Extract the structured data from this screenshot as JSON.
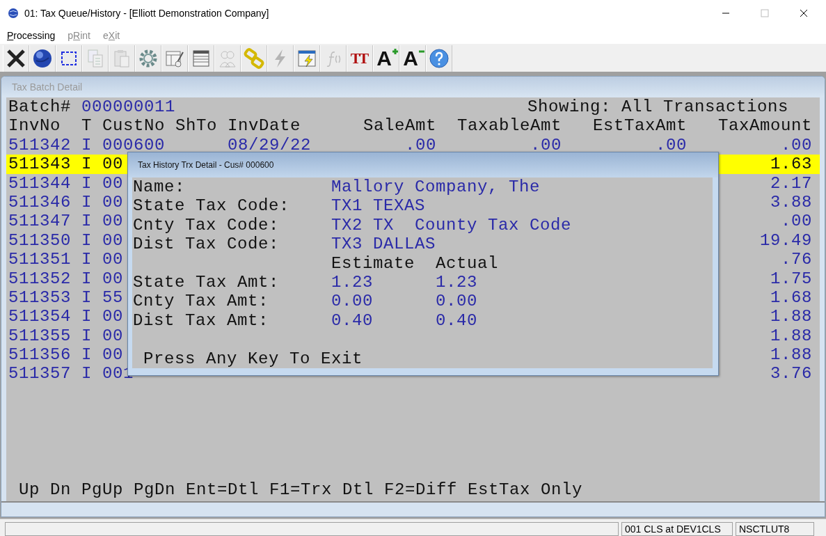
{
  "window": {
    "title": "01: Tax Queue/History - [Elliott Demonstration Company]"
  },
  "menu": [
    {
      "key": "P",
      "after": "rocessing",
      "disabled": false
    },
    {
      "before": "p",
      "key": "R",
      "after": "int",
      "disabled": true
    },
    {
      "before": "e",
      "key": "X",
      "after": "it",
      "disabled": true
    }
  ],
  "toolbar": [
    {
      "kind": "close",
      "disabled": false
    },
    {
      "kind": "globe",
      "disabled": false
    },
    {
      "kind": "select",
      "disabled": false
    },
    {
      "kind": "copy",
      "disabled": true
    },
    {
      "kind": "paste",
      "disabled": true
    },
    {
      "kind": "gear",
      "disabled": false
    },
    {
      "kind": "form",
      "disabled": false
    },
    {
      "kind": "table",
      "disabled": false
    },
    {
      "kind": "people",
      "disabled": true
    },
    {
      "kind": "link",
      "disabled": false
    },
    {
      "kind": "bolt",
      "disabled": true
    },
    {
      "kind": "run",
      "disabled": false
    },
    {
      "kind": "function",
      "disabled": true
    },
    {
      "kind": "text",
      "glyph": "TT",
      "disabled": false
    },
    {
      "kind": "grow",
      "glyph": "A",
      "disabled": false
    },
    {
      "kind": "shrink",
      "glyph": "A",
      "disabled": false
    },
    {
      "kind": "help",
      "disabled": false
    }
  ],
  "child_window": {
    "title": "Tax Batch Detail"
  },
  "batch": {
    "label": "Batch#",
    "value": "000000011",
    "showing": "Showing: All Transactions"
  },
  "table": {
    "columns": [
      "InvNo",
      "T",
      "CustNo",
      "ShTo",
      "InvDate",
      "SaleAmt",
      "TaxableAmt",
      "EstTaxAmt",
      "TaxAmount"
    ],
    "rows": [
      {
        "invno": "511342",
        "t": "I",
        "custno": "000600",
        "invdate": "08/29/22",
        "sale_amt": ".00",
        "taxable_amt": ".00",
        "est_tax_amt": ".00",
        "tax_amount": ".00",
        "selected": false
      },
      {
        "invno": "511343",
        "t": "I",
        "custno": "00",
        "tax_amount": "1.63",
        "selected": true
      },
      {
        "invno": "511344",
        "t": "I",
        "custno": "00",
        "tax_amount": "2.17",
        "selected": false
      },
      {
        "invno": "511346",
        "t": "I",
        "custno": "00",
        "tax_amount": "3.88",
        "selected": false
      },
      {
        "invno": "511347",
        "t": "I",
        "custno": "00",
        "tax_amount": ".00",
        "selected": false
      },
      {
        "invno": "511350",
        "t": "I",
        "custno": "00",
        "tax_amount": "19.49",
        "selected": false
      },
      {
        "invno": "511351",
        "t": "I",
        "custno": "00",
        "tax_amount": ".76",
        "selected": false
      },
      {
        "invno": "511352",
        "t": "I",
        "custno": "00",
        "tax_amount": "1.75",
        "selected": false
      },
      {
        "invno": "511353",
        "t": "I",
        "custno": "55",
        "tax_amount": "1.68",
        "selected": false
      },
      {
        "invno": "511354",
        "t": "I",
        "custno": "00",
        "tax_amount": "1.88",
        "selected": false
      },
      {
        "invno": "511355",
        "t": "I",
        "custno": "00",
        "tax_amount": "1.88",
        "selected": false
      },
      {
        "invno": "511356",
        "t": "I",
        "custno": "00",
        "tax_amount": "1.88",
        "selected": false
      },
      {
        "invno": "511357",
        "t": "I",
        "custno": "001",
        "tax_amount": "3.76",
        "selected": false
      }
    ]
  },
  "footer": "Up Dn PgUp PgDn Ent=Dtl F1=Trx Dtl F2=Diff EstTax Only",
  "detail_dialog": {
    "title": "Tax History Trx Detail - Cus# 000600",
    "fields": [
      {
        "label": "Name:",
        "value": "Mallory Company, The"
      },
      {
        "label": "State Tax Code:",
        "value": "TX1 TEXAS"
      },
      {
        "label": "Cnty Tax Code:",
        "value": "TX2 TX  County Tax Code"
      },
      {
        "label": "Dist Tax Code:",
        "value": "TX3 DALLAS"
      }
    ],
    "amount_headers": [
      "Estimate",
      "Actual"
    ],
    "amounts": [
      {
        "label": "State Tax Amt:",
        "estimate": "1.23",
        "actual": "1.23"
      },
      {
        "label": "Cnty Tax Amt:",
        "estimate": "0.00",
        "actual": "0.00"
      },
      {
        "label": "Dist Tax Amt:",
        "estimate": "0.40",
        "actual": "0.40"
      }
    ],
    "prompt": "Press Any Key To Exit"
  },
  "status_bar": {
    "panels": [
      "001 CLS at DEV1CLS",
      "NSCTLUT8"
    ]
  }
}
